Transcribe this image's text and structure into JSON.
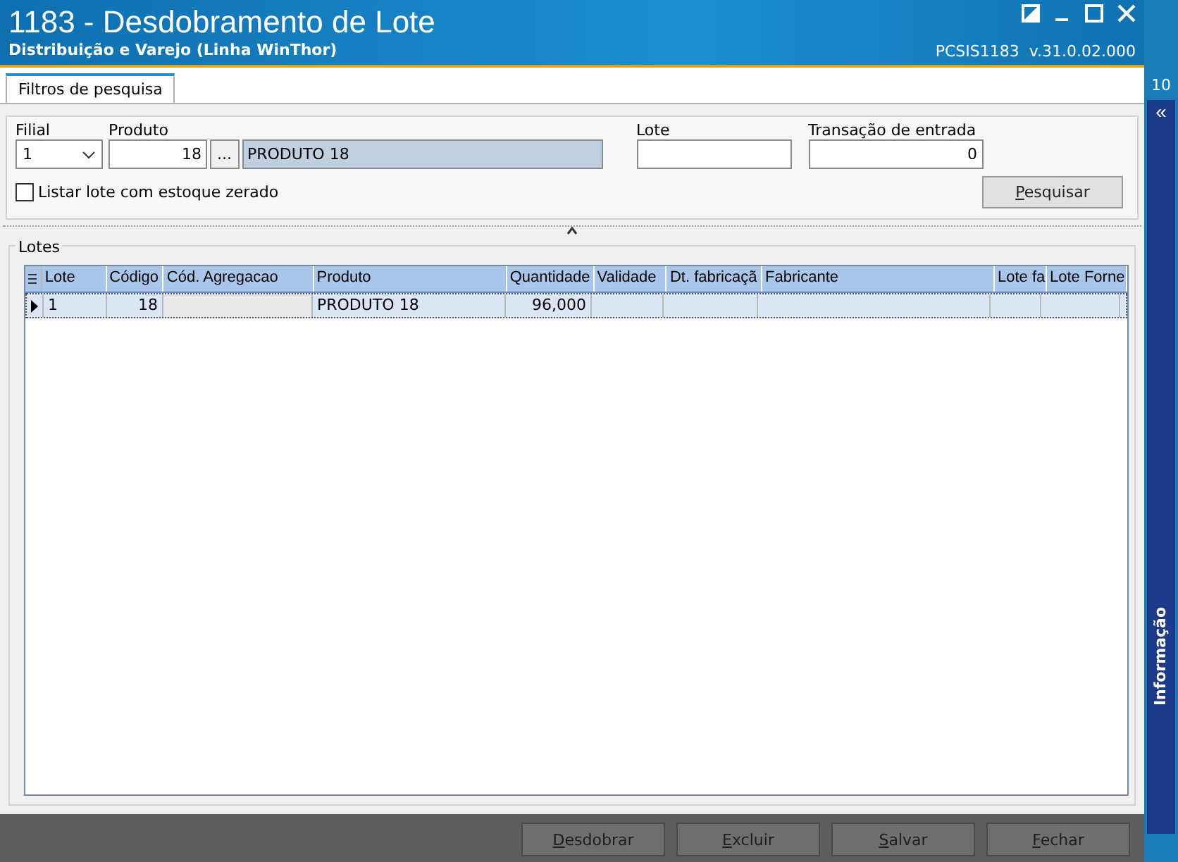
{
  "window": {
    "title": "1183 - Desdobramento de Lote",
    "subtitle": "Distribuição e Varejo (Linha WinThor)",
    "version": "PCSIS1183  v.31.0.02.000"
  },
  "tabs": [
    {
      "label": "Filtros de pesquisa",
      "selected": true
    }
  ],
  "filters": {
    "filial": {
      "label": "Filial",
      "value": "1"
    },
    "produto": {
      "label": "Produto",
      "code": "18",
      "browse": "...",
      "name": "PRODUTO 18"
    },
    "lote": {
      "label": "Lote"
    },
    "transacao": {
      "label": "Transação de entrada",
      "value": "0"
    },
    "zero_stock": {
      "label": "Listar lote com estoque zerado",
      "checked": false
    },
    "search_button": "Pesquisar"
  },
  "lotes": {
    "title": "Lotes",
    "columns": [
      "Lote",
      "Código",
      "Cód. Agregacao",
      "Produto",
      "Quantidade",
      "Validade",
      "Dt. fabricaçã",
      "Fabricante",
      "Lote fa",
      "Lote Forne"
    ],
    "rows": [
      {
        "selected": true,
        "cells": [
          "1",
          "18",
          "",
          "PRODUTO 18",
          "96,000",
          "",
          "",
          "",
          "",
          ""
        ]
      }
    ]
  },
  "buttons": [
    "Desdobrar",
    "Excluir",
    "Salvar",
    "Fechar"
  ],
  "side_panel": {
    "number": "10",
    "collapse": "«",
    "label": "Informação"
  }
}
